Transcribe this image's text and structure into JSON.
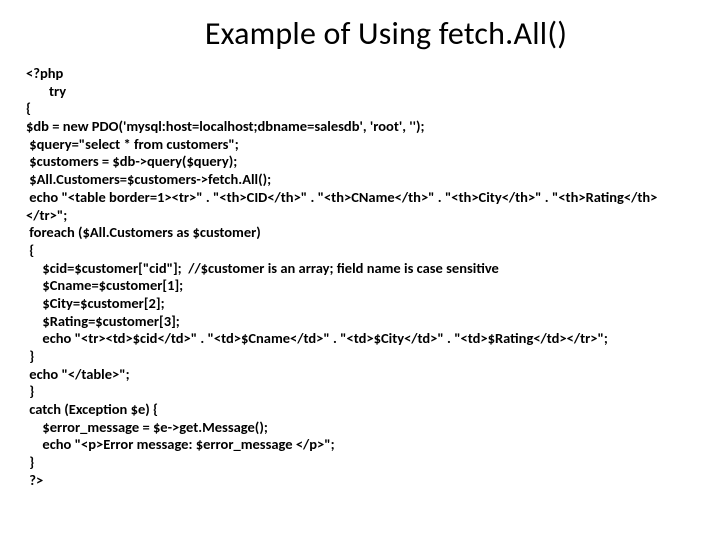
{
  "title": "Example of Using fetch.All()",
  "code_lines": [
    "<?php",
    "       try",
    "{",
    "$db = new PDO('mysql:host=localhost;dbname=salesdb', 'root', '');",
    " $query=\"select * from customers\";",
    " $customers = $db->query($query);",
    " $All.Customers=$customers->fetch.All();",
    " echo \"<table border=1><tr>\" . \"<th>CID</th>\" . \"<th>CName</th>\" . \"<th>City</th>\" . \"<th>Rating</th></tr>\";",
    " foreach ($All.Customers as $customer)",
    " {",
    "     $cid=$customer[\"cid\"];  //$customer is an array; field name is case sensitive",
    "     $Cname=$customer[1];",
    "     $City=$customer[2];",
    "     $Rating=$customer[3];",
    "     echo \"<tr><td>$cid</td>\" . \"<td>$Cname</td>\" . \"<td>$City</td>\" . \"<td>$Rating</td></tr>\";",
    " }",
    " echo \"</table>\";",
    " }",
    " catch (Exception $e) {",
    "     $error_message = $e->get.Message();",
    "     echo \"<p>Error message: $error_message </p>\";",
    " }",
    " ?>"
  ]
}
